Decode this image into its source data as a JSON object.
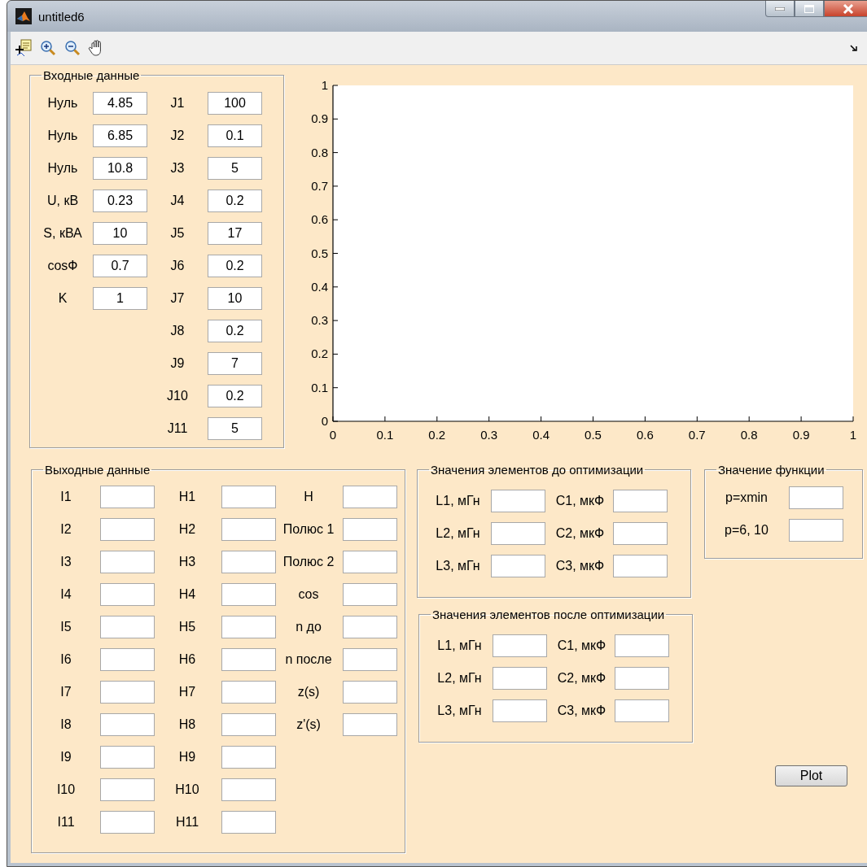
{
  "window": {
    "title": "untitled6"
  },
  "input_panel": {
    "title": "Входные данные",
    "columns": [
      [
        {
          "label": "Нуль",
          "value": "4.85"
        },
        {
          "label": "Нуль",
          "value": "6.85"
        },
        {
          "label": "Нуль",
          "value": "10.8"
        },
        {
          "label": "U, кВ",
          "value": "0.23"
        },
        {
          "label": "S, кВА",
          "value": "10"
        },
        {
          "label": "cosФ",
          "value": "0.7"
        },
        {
          "label": "K",
          "value": "1"
        }
      ],
      [
        {
          "label": "J1",
          "value": "100"
        },
        {
          "label": "J2",
          "value": "0.1"
        },
        {
          "label": "J3",
          "value": "5"
        },
        {
          "label": "J4",
          "value": "0.2"
        },
        {
          "label": "J5",
          "value": "17"
        },
        {
          "label": "J6",
          "value": "0.2"
        },
        {
          "label": "J7",
          "value": "10"
        },
        {
          "label": "J8",
          "value": "0.2"
        },
        {
          "label": "J9",
          "value": "7"
        },
        {
          "label": "J10",
          "value": "0.2"
        },
        {
          "label": "J11",
          "value": "5"
        }
      ]
    ]
  },
  "axes": {
    "chart_data": {
      "type": "line",
      "xlim": [
        0,
        1
      ],
      "ylim": [
        0,
        1
      ],
      "xticks": [
        {
          "value": 0,
          "label": "0"
        },
        {
          "value": 0.1,
          "label": "0.1"
        },
        {
          "value": 0.2,
          "label": "0.2"
        },
        {
          "value": 0.3,
          "label": "0.3"
        },
        {
          "value": 0.4,
          "label": "0.4"
        },
        {
          "value": 0.5,
          "label": "0.5"
        },
        {
          "value": 0.6,
          "label": "0.6"
        },
        {
          "value": 0.7,
          "label": "0.7"
        },
        {
          "value": 0.8,
          "label": "0.8"
        },
        {
          "value": 0.9,
          "label": "0.9"
        },
        {
          "value": 1,
          "label": "1"
        }
      ],
      "yticks": [
        {
          "value": 0,
          "label": "0"
        },
        {
          "value": 0.1,
          "label": "0.1"
        },
        {
          "value": 0.2,
          "label": "0.2"
        },
        {
          "value": 0.3,
          "label": "0.3"
        },
        {
          "value": 0.4,
          "label": "0.4"
        },
        {
          "value": 0.5,
          "label": "0.5"
        },
        {
          "value": 0.6,
          "label": "0.6"
        },
        {
          "value": 0.7,
          "label": "0.7"
        },
        {
          "value": 0.8,
          "label": "0.8"
        },
        {
          "value": 0.9,
          "label": "0.9"
        },
        {
          "value": 1,
          "label": "1"
        }
      ]
    }
  },
  "output_panel": {
    "title": "Выходные данные",
    "columns": [
      [
        {
          "label": "I1"
        },
        {
          "label": "I2"
        },
        {
          "label": "I3"
        },
        {
          "label": "I4"
        },
        {
          "label": "I5"
        },
        {
          "label": "I6"
        },
        {
          "label": "I7"
        },
        {
          "label": "I8"
        },
        {
          "label": "I9"
        },
        {
          "label": "I10"
        },
        {
          "label": "I11"
        }
      ],
      [
        {
          "label": "H1"
        },
        {
          "label": "H2"
        },
        {
          "label": "H3"
        },
        {
          "label": "H4"
        },
        {
          "label": "H5"
        },
        {
          "label": "H6"
        },
        {
          "label": "H7"
        },
        {
          "label": "H8"
        },
        {
          "label": "H9"
        },
        {
          "label": "H10"
        },
        {
          "label": "H11"
        }
      ],
      [
        {
          "label": "H"
        },
        {
          "label": "Полюс 1"
        },
        {
          "label": "Полюс 2"
        },
        {
          "label": "cos"
        },
        {
          "label": "n до"
        },
        {
          "label": "n после"
        },
        {
          "label": "z(s)"
        },
        {
          "label": "z'(s)"
        }
      ]
    ]
  },
  "before_panel": {
    "title": "Значения элементов до оптимизации",
    "columns": [
      [
        {
          "label": "L1, мГн"
        },
        {
          "label": "L2, мГн"
        },
        {
          "label": "L3, мГн"
        }
      ],
      [
        {
          "label": "C1, мкФ"
        },
        {
          "label": "C2, мкФ"
        },
        {
          "label": "C3, мкФ"
        }
      ]
    ]
  },
  "function_panel": {
    "title": "Значение функции",
    "columns": [
      [
        {
          "label": "p=xmin"
        },
        {
          "label": "p=6, 10"
        }
      ]
    ]
  },
  "after_panel": {
    "title": "Значения элементов после оптимизации",
    "columns": [
      [
        {
          "label": "L1, мГн"
        },
        {
          "label": "L2, мГн"
        },
        {
          "label": "L3, мГн"
        }
      ],
      [
        {
          "label": "C1, мкФ"
        },
        {
          "label": "C2, мкФ"
        },
        {
          "label": "C3, мкФ"
        }
      ]
    ]
  },
  "plot_button": "Plot"
}
